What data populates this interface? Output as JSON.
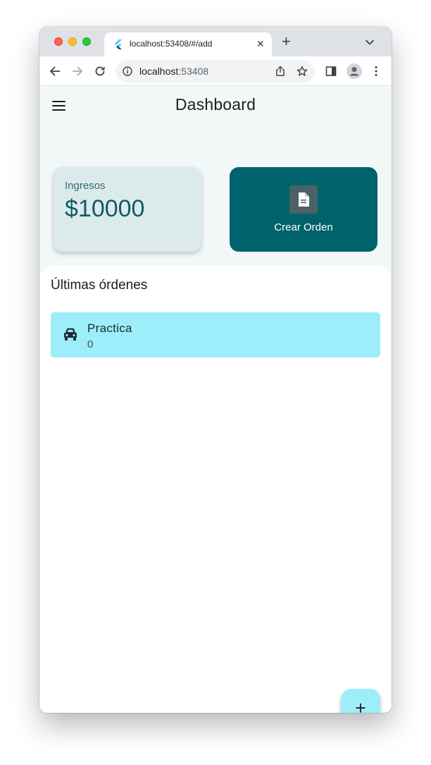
{
  "browser": {
    "tab_title": "localhost:53408/#/add",
    "url_host": "localhost",
    "url_port": ":53408",
    "tab_close": "✕",
    "new_tab": "+"
  },
  "app": {
    "title": "Dashboard",
    "ingresos": {
      "label": "Ingresos",
      "value": "$10000"
    },
    "crear_orden": {
      "label": "Crear Orden"
    },
    "section_title": "Últimas órdenes",
    "orders": [
      {
        "name": "Practica",
        "count": "0"
      }
    ],
    "fab_label": "+"
  },
  "colors": {
    "primary": "#00626c",
    "accent": "#9eedfb",
    "card_light": "#ddeaeb",
    "background": "#f2f8f8"
  }
}
